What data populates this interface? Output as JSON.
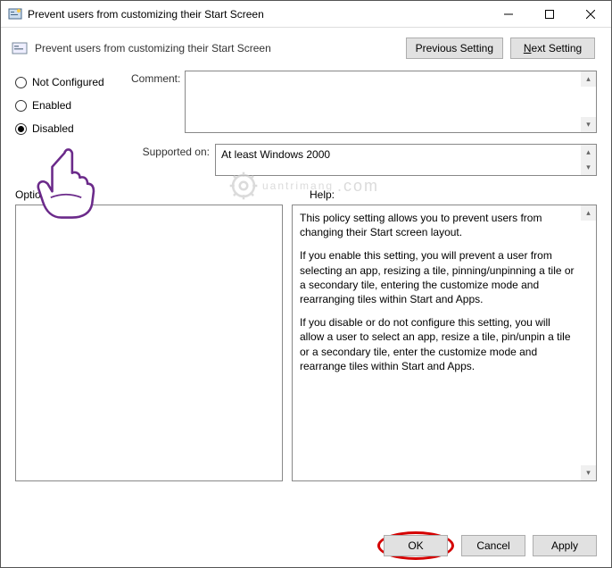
{
  "window": {
    "title": "Prevent users from customizing their Start Screen"
  },
  "header": {
    "policy_name": "Prevent users from customizing their Start Screen",
    "prev_button": "Previous Setting",
    "next_button_text_before": "",
    "next_button_accel": "N",
    "next_button_text_after": "ext Setting"
  },
  "radios": {
    "not_configured": "Not Configured",
    "enabled": "Enabled",
    "disabled": "Disabled",
    "selected": "disabled"
  },
  "fields": {
    "comment_label": "Comment:",
    "comment_value": "",
    "supported_label": "Supported on:",
    "supported_value": "At least Windows 2000"
  },
  "sections": {
    "options_label": "Options:",
    "help_label": "Help:"
  },
  "help_text": {
    "p1": "This policy setting allows you to prevent users from changing their Start screen layout.",
    "p2": "If you enable this setting, you will prevent a user from selecting an app, resizing a tile, pinning/unpinning a tile or a secondary tile, entering the customize mode and rearranging tiles within Start and Apps.",
    "p3": "If you disable or do not configure this setting, you will allow a user to select an app, resize a tile, pin/unpin a tile or a secondary tile, enter the customize mode and rearrange tiles within Start and Apps."
  },
  "footer": {
    "ok": "OK",
    "cancel": "Cancel",
    "apply": "Apply"
  },
  "watermark": {
    "text": "uantrimang"
  }
}
